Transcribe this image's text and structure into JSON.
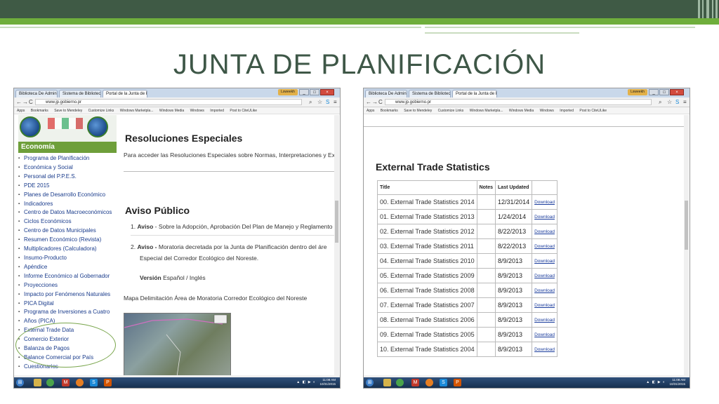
{
  "slide": {
    "title": "JUNTA DE PLANIFICACIÓN"
  },
  "browser": {
    "tabs": [
      "Biblioteca De Administrac",
      "Sistema de Bibliotecas",
      "Portal de la Junta de Plan"
    ],
    "user_badge": "Lsweekh",
    "url": "www.jp.gobierno.pr",
    "bookmarks": [
      "Apps",
      "Bookmarks",
      "Save to Mendeley",
      "Customize Links",
      "Windows Marketpla...",
      "Windows Media",
      "Windows",
      "Imported",
      "Post to CiteULike"
    ],
    "nav": {
      "back": "←",
      "forward": "→",
      "reload": "C"
    }
  },
  "left_page": {
    "sidebar_header": "Economía",
    "sidebar_items": [
      "Programa de Planificación",
      "Económica y Social",
      "Personal del P.P.E.S.",
      "PDE 2015",
      "Planes de Desarrollo Económico",
      "Indicadores",
      "Centro de Datos Macroeconómicos",
      "Ciclos Económicos",
      "Centro de Datos Municipales",
      "Resumen Económico (Revista)",
      "Multiplicadores (Calculadora)",
      "Insumo-Producto",
      "Apéndice",
      "Informe Económico al Gobernador",
      "Proyecciones",
      "Impacto por Fenómenos Naturales",
      "PICA Digital",
      "Programa de Inversiones a Cuatro",
      "Años (PICA)",
      "External Trade Data",
      "Comercio Exterior",
      "Balanza de Pagos",
      "Balance Comercial por País",
      "Cuestionarios"
    ],
    "resoluciones_title": "Resoluciones Especiales",
    "resoluciones_text": "Para acceder las Resoluciones Especiales sobre Normas, Interpretaciones y Exi",
    "aviso_title": "Aviso Público",
    "aviso_1_num": "1.",
    "aviso_1_bold": "Aviso",
    "aviso_1_text": " - Sobre la Adopción, Aprobación Del Plan de Manejo y Reglamento",
    "aviso_2_num": "2.",
    "aviso_2_bold": "Aviso -",
    "aviso_2_text": " Moratoria decretada por la Junta de Planificación dentro del áre",
    "aviso_2_line2": "Especial del Corredor Ecológico del Noreste.",
    "version_label": "Versión",
    "version_links": " Español / Inglés",
    "map_caption": "Mapa Delimitación Área de Moratoria Corredor Ecológico del Noreste"
  },
  "right_page": {
    "title": "External Trade Statistics",
    "columns": [
      "Title",
      "Notes",
      "Last Updated",
      ""
    ],
    "rows": [
      [
        "00. External Trade Statistics 2014",
        "",
        "12/31/2014",
        "Download"
      ],
      [
        "01. External Trade Statistics 2013",
        "",
        "1/24/2014",
        "Download"
      ],
      [
        "02. External Trade Statistics 2012",
        "",
        "8/22/2013",
        "Download"
      ],
      [
        "03. External Trade Statistics 2011",
        "",
        "8/22/2013",
        "Download"
      ],
      [
        "04. External Trade Statistics 2010",
        "",
        "8/9/2013",
        "Download"
      ],
      [
        "05. External Trade Statistics 2009",
        "",
        "8/9/2013",
        "Download"
      ],
      [
        "06. External Trade Statistics 2008",
        "",
        "8/9/2013",
        "Download"
      ],
      [
        "07. External Trade Statistics 2007",
        "",
        "8/9/2013",
        "Download"
      ],
      [
        "08. External Trade Statistics 2006",
        "",
        "8/9/2013",
        "Download"
      ],
      [
        "09. External Trade Statistics 2005",
        "",
        "8/9/2013",
        "Download"
      ],
      [
        "10. External Trade Statistics 2004",
        "",
        "8/9/2013",
        "Download"
      ]
    ]
  },
  "taskbar": {
    "time": "11:08 AM",
    "date": "10/31/2015"
  },
  "colors": {
    "title": "#3e5747",
    "band_dark": "#3f5a45",
    "band_green": "#6fae3c",
    "sidebar_header": "#6e9f3a",
    "link": "#1a3c8c"
  }
}
